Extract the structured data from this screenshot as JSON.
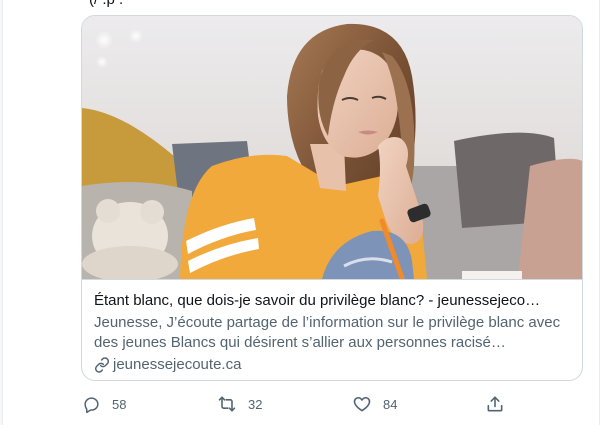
{
  "tweet": {
    "cutoff_text": "(/ .p  .",
    "card": {
      "title": "Étant blanc, que dois-je savoir du privilège blanc? - jeunessejeco…",
      "description": "Jeunesse, J’écoute partage de l’information sur le privilège blanc avec des jeunes Blancs qui désirent s’allier aux personnes racisé…",
      "domain": "jeunessejecoute.ca",
      "domain_icon": "link-icon",
      "image_alt": "young-woman-yellow-shirt-thinking"
    },
    "actions": {
      "reply": {
        "icon": "reply-icon",
        "count": "58"
      },
      "retweet": {
        "icon": "retweet-icon",
        "count": "32"
      },
      "like": {
        "icon": "like-icon",
        "count": "84"
      },
      "share": {
        "icon": "share-icon"
      }
    }
  },
  "colors": {
    "text_primary": "#0f1419",
    "text_secondary": "#536471",
    "border": "#cfd9de",
    "shirt_yellow": "#f2a93b"
  }
}
